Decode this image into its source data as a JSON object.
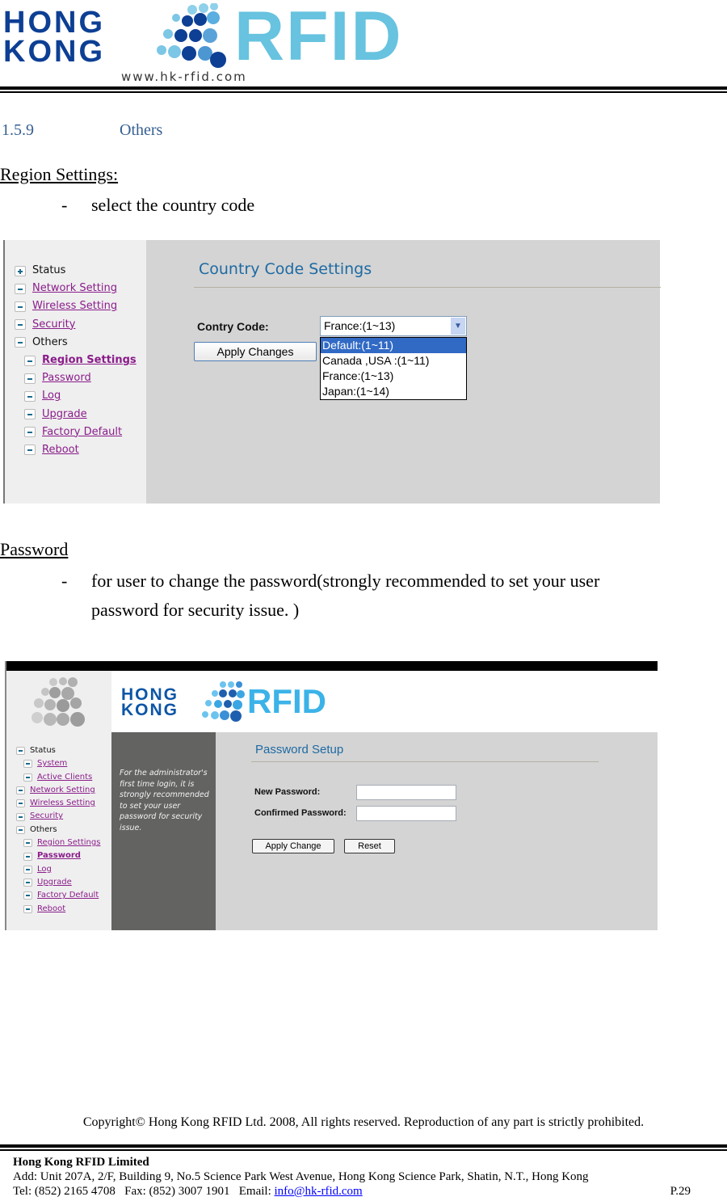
{
  "header": {
    "logo_line1": "HONG",
    "logo_line2": "KONG",
    "logo_brand": "RFID",
    "logo_url": "www.hk-rfid.com"
  },
  "section": {
    "number": "1.5.9",
    "title": "Others"
  },
  "region": {
    "heading": "Region Settings:",
    "bullet_dash": "-",
    "bullet_text": "select the country code"
  },
  "screenshot1": {
    "nav": [
      {
        "label": "Status",
        "icon": "plus-icon",
        "link": false,
        "level": 0
      },
      {
        "label": "Network Setting",
        "icon": "minus-icon",
        "link": true,
        "level": 0
      },
      {
        "label": "Wireless Setting",
        "icon": "minus-icon",
        "link": true,
        "level": 0
      },
      {
        "label": "Security",
        "icon": "minus-icon",
        "link": true,
        "level": 0
      },
      {
        "label": "Others",
        "icon": "minus-icon",
        "link": false,
        "level": 0
      },
      {
        "label": "Region Settings",
        "icon": "minus-icon",
        "link": true,
        "level": 1,
        "active": true
      },
      {
        "label": "Password",
        "icon": "minus-icon",
        "link": true,
        "level": 1
      },
      {
        "label": "Log",
        "icon": "minus-icon",
        "link": true,
        "level": 1
      },
      {
        "label": "Upgrade",
        "icon": "minus-icon",
        "link": true,
        "level": 1
      },
      {
        "label": "Factory Default",
        "icon": "minus-icon",
        "link": true,
        "level": 1
      },
      {
        "label": "Reboot",
        "icon": "minus-icon",
        "link": true,
        "level": 1
      }
    ],
    "title": "Country Code Settings",
    "field_label": "Contry Code:",
    "selected_value": "France:(1~13)",
    "options": [
      "Default:(1~11)",
      "Canada ,USA :(1~11)",
      "France:(1~13)",
      "Japan:(1~14)"
    ],
    "highlighted_option": "Default:(1~11)",
    "apply_label": "Apply Changes",
    "colors": {
      "title": "#1d6aa3",
      "link": "#8a1d8a",
      "highlight": "#316ac5"
    }
  },
  "password": {
    "heading": "Password",
    "bullet_dash": "-",
    "bullet_line1": "for user to change the password(strongly recommended to set your user",
    "bullet_line2": "password for security issue. )"
  },
  "screenshot2": {
    "logo_line1": "HONG",
    "logo_line2": "KONG",
    "logo_brand": "RFID",
    "nav": [
      {
        "label": "Status",
        "link": false,
        "level": 0
      },
      {
        "label": "System",
        "link": true,
        "level": 1
      },
      {
        "label": "Active Clients",
        "link": true,
        "level": 1
      },
      {
        "label": "Network Setting",
        "link": true,
        "level": 0
      },
      {
        "label": "Wireless Setting",
        "link": true,
        "level": 0
      },
      {
        "label": "Security",
        "link": true,
        "level": 0
      },
      {
        "label": "Others",
        "link": false,
        "level": 0
      },
      {
        "label": "Region Settings",
        "link": true,
        "level": 1
      },
      {
        "label": "Password",
        "link": true,
        "level": 1,
        "active": true
      },
      {
        "label": "Log",
        "link": true,
        "level": 1
      },
      {
        "label": "Upgrade",
        "link": true,
        "level": 1
      },
      {
        "label": "Factory Default",
        "link": true,
        "level": 1
      },
      {
        "label": "Reboot",
        "link": true,
        "level": 1
      }
    ],
    "note": "For the administrator's first time login, it is strongly recommended to set your user password for security issue.",
    "title": "Password Setup",
    "new_password_label": "New Password:",
    "new_password_value": "",
    "confirm_password_label": "Confirmed Password:",
    "confirm_password_value": "",
    "apply_label": "Apply Change",
    "reset_label": "Reset"
  },
  "footer": {
    "copyright": "Copyright© Hong Kong RFID Ltd. 2008, All rights reserved. Reproduction of any part is strictly prohibited.",
    "company": "Hong Kong RFID Limited",
    "address": "Add: Unit 207A, 2/F, Building 9, No.5 Science Park West Avenue, Hong Kong Science Park, Shatin, N.T., Hong Kong",
    "contact_prefix": "Tel: (852) 2165 4708   Fax: (852) 3007 1901   Email: ",
    "email": "info@hk-rfid.com",
    "page": "P.29"
  }
}
